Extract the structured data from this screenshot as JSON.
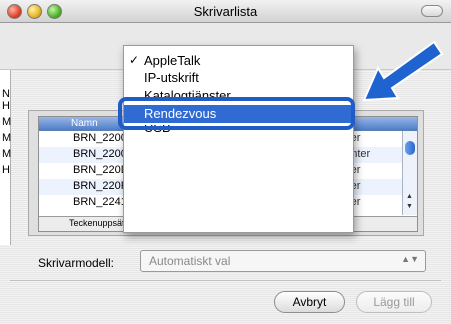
{
  "window": {
    "title": "Skrivarlista",
    "left_letters": [
      "N",
      "H",
      "M",
      "M",
      "M",
      "H"
    ]
  },
  "popup_menu": {
    "items": [
      {
        "label": "AppleTalk",
        "checked": true
      },
      {
        "label": "IP-utskrift",
        "checked": false
      },
      {
        "label": "Katalogtjänster",
        "checked": false
      },
      {
        "label": "Rendezvous",
        "checked": false,
        "selected": true
      },
      {
        "label": "USB",
        "checked": false
      }
    ],
    "check_mark": "✓"
  },
  "printer_list": {
    "column_header": "Namn",
    "rows": [
      {
        "name": "BRN_22002C",
        "type": "aser"
      },
      {
        "name": "BRN_22002C",
        "type": "printer"
      },
      {
        "name": "BRN_220DB",
        "type": "aser"
      },
      {
        "name": "BRN_220FB5",
        "type": "aser"
      },
      {
        "name": "BRN_22416",
        "type": "aser"
      }
    ],
    "encoding_label": "Teckenuppsättning: västerländsk"
  },
  "model": {
    "label": "Skrivarmodell:",
    "value": "Automatiskt val"
  },
  "buttons": {
    "cancel": "Avbryt",
    "add": "Lägg till"
  },
  "colors": {
    "highlight": "#1f5cc7",
    "arrow": "#1f63d0",
    "menu_selection": "#2f6bd3"
  }
}
